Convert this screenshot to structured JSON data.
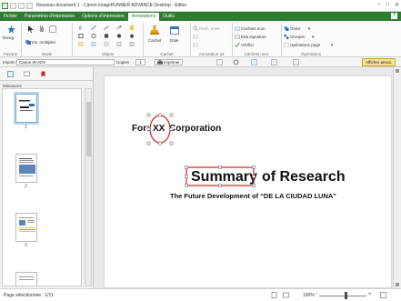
{
  "window": {
    "title": "Nouveau document 1 - Canon imageRUNNER ADVANCE Desktop - Editor"
  },
  "ribbon_tabs": [
    "Fichier",
    "Paramètres d'impression",
    "Options d'impression",
    "Annotations",
    "Outils"
  ],
  "active_tab": "Annotations",
  "ribbon": {
    "favoris": {
      "button": "Enreg.",
      "label": "Favoris"
    },
    "mode": {
      "button": "Ins. multiples",
      "label": "Mode"
    },
    "objets": {
      "label": "Objets"
    },
    "cachet": {
      "button1": "Cachet",
      "button2": "Date",
      "label": "Cachet"
    },
    "annotation_txt": {
      "items": [
        "Rech. texte"
      ],
      "label": "Annotation txt"
    },
    "cachets_num": {
      "items": [
        "Cachets num.",
        "Etat signature",
        "Vérifier"
      ],
      "label": "Cachets num."
    },
    "operations": {
      "items": [
        "Ordre",
        "Grouper",
        "Opérations page"
      ],
      "label": "Opérations"
    }
  },
  "toolbar2": {
    "printer_label": "Imprim :",
    "printer_value": "Canon iR-ADV",
    "copies_label": "Copies",
    "copies_value": "1",
    "print_button": "Imprimer",
    "show_annotations": "Afficher annot."
  },
  "left_panel": {
    "header": "Miniatures",
    "pages": [
      "1",
      "2",
      "3"
    ]
  },
  "document": {
    "line1_prefix": "For:",
    "line1_highlight": "XX",
    "line1_suffix": "Corporation",
    "title_highlight": "Summary",
    "title_rest": "of Research",
    "subtitle": "The Future Development of “DE LA CIUDAD LUNA”"
  },
  "status": {
    "page_text": "Page sélectionnée : 1/11",
    "zoom": "100%"
  },
  "colors": {
    "accent_green": "#2e7b32",
    "annotation_red": "#d02020",
    "highlight_yellow": "#f7e38a"
  }
}
